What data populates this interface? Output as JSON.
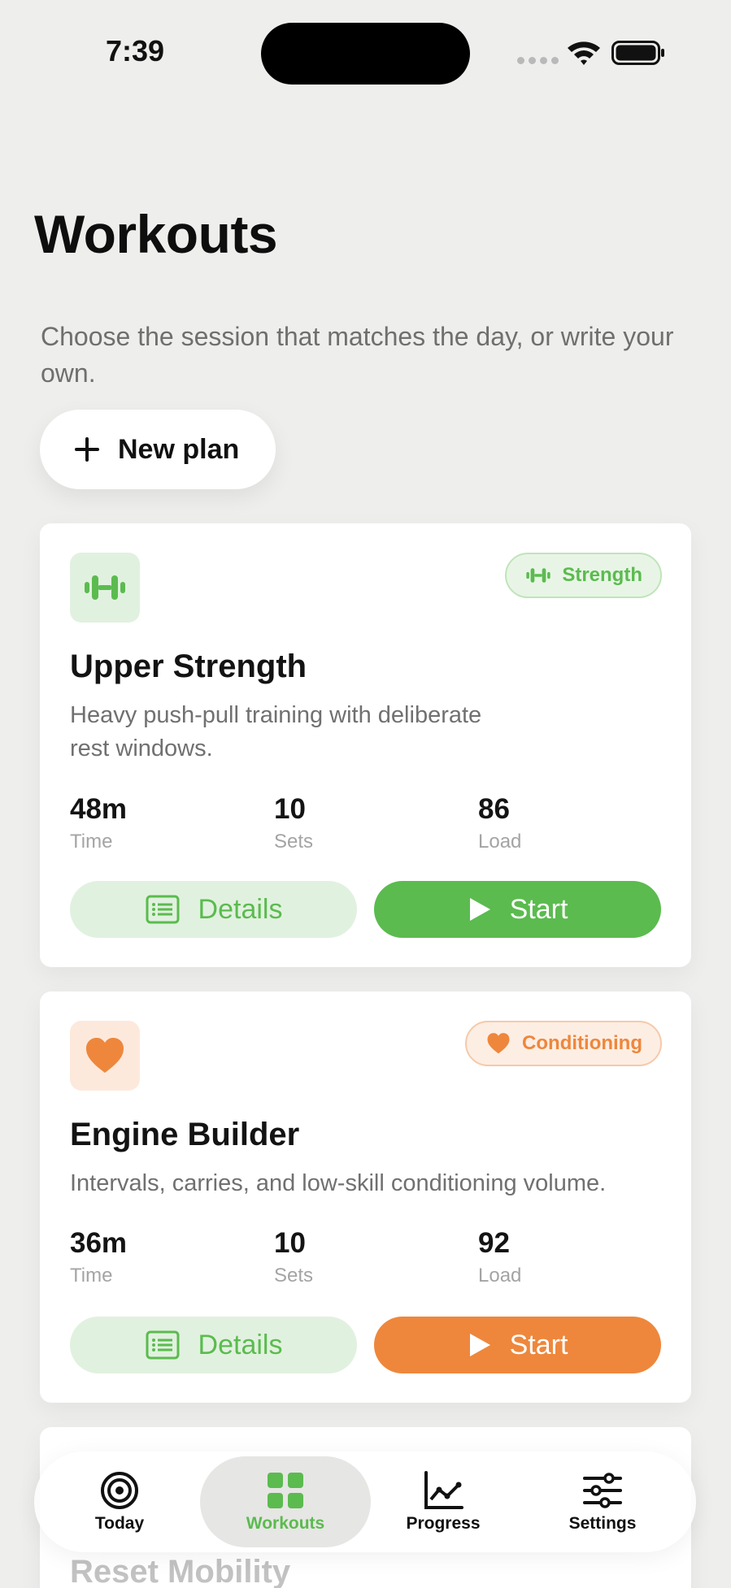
{
  "status_bar": {
    "time": "7:39"
  },
  "header": {
    "title": "Workouts",
    "subtitle": "Choose the session that matches the day, or write your own.",
    "new_plan_label": "New plan"
  },
  "colors": {
    "green": "#5bbb4f",
    "green_soft": "#e1f1df",
    "orange": "#ee873c",
    "orange_soft": "#fde9dc"
  },
  "workouts": [
    {
      "icon": "dumbbell-icon",
      "tag": "Strength",
      "title": "Upper Strength",
      "description_lines": [
        "Heavy push-pull training with deliberate",
        "rest windows."
      ],
      "stats": [
        {
          "value": "48m",
          "label": "Time"
        },
        {
          "value": "10",
          "label": "Sets"
        },
        {
          "value": "86",
          "label": "Load"
        }
      ],
      "details_label": "Details",
      "start_label": "Start"
    },
    {
      "icon": "heart-icon",
      "tag": "Conditioning",
      "title": "Engine Builder",
      "description_lines": [
        "Intervals, carries, and low-skill conditioning volume."
      ],
      "stats": [
        {
          "value": "36m",
          "label": "Time"
        },
        {
          "value": "10",
          "label": "Sets"
        },
        {
          "value": "92",
          "label": "Load"
        }
      ],
      "details_label": "Details",
      "start_label": "Start"
    },
    {
      "title": "Reset Mobility"
    }
  ],
  "tabbar": {
    "items": [
      {
        "label": "Today",
        "icon": "target-icon"
      },
      {
        "label": "Workouts",
        "icon": "grid-icon",
        "active": true
      },
      {
        "label": "Progress",
        "icon": "chart-icon"
      },
      {
        "label": "Settings",
        "icon": "sliders-icon"
      }
    ]
  }
}
